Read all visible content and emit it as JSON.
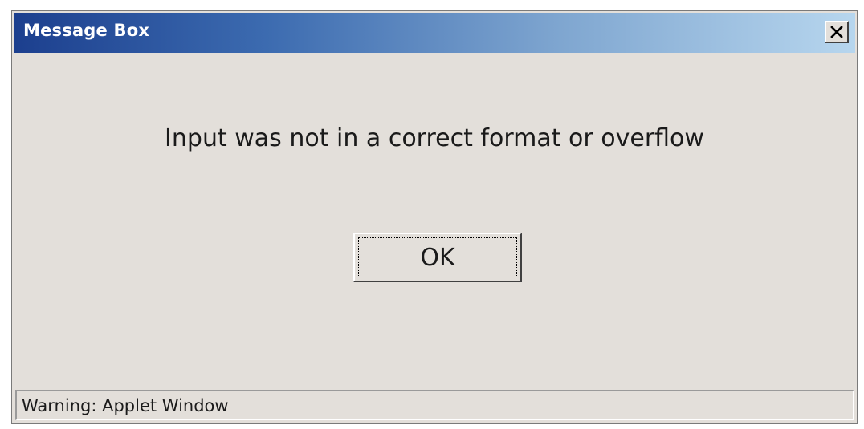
{
  "window": {
    "title": "Message Box"
  },
  "dialog": {
    "message": "Input was not in a correct format or overflow",
    "ok_label": "OK"
  },
  "statusbar": {
    "text": "Warning: Applet Window"
  },
  "icons": {
    "close": "close-icon"
  },
  "colors": {
    "titlebar_start": "#1c3f8e",
    "titlebar_end": "#b7d6ee",
    "window_bg": "#e3dfda",
    "title_text": "#ffffff"
  }
}
